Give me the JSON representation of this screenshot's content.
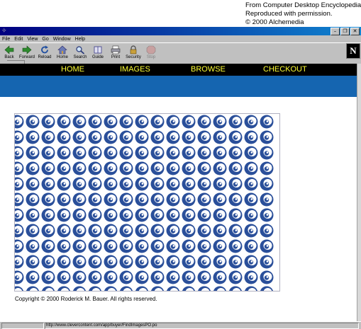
{
  "credit": {
    "line1": "From Computer Desktop Encyclopedia",
    "line2": "Reproduced with permission.",
    "line3": "© 2000 Alchemedia"
  },
  "menu": [
    "File",
    "Edit",
    "View",
    "Go",
    "Window",
    "Help"
  ],
  "toolbar": [
    {
      "label": "Back",
      "icon": "back-arrow-icon",
      "enabled": true
    },
    {
      "label": "Forward",
      "icon": "forward-arrow-icon",
      "enabled": true
    },
    {
      "label": "Reload",
      "icon": "reload-icon",
      "enabled": true
    },
    {
      "label": "Home",
      "icon": "home-icon",
      "enabled": true
    },
    {
      "label": "Search",
      "icon": "search-icon",
      "enabled": true
    },
    {
      "label": "Guide",
      "icon": "guide-icon",
      "enabled": true
    },
    {
      "label": "Print",
      "icon": "printer-icon",
      "enabled": true
    },
    {
      "label": "Security",
      "icon": "lock-icon",
      "enabled": true
    },
    {
      "label": "Stop",
      "icon": "stop-icon",
      "enabled": false
    }
  ],
  "logo": "N",
  "nav": {
    "home": "HOME",
    "images": "IMAGES",
    "browse": "BROWSE",
    "checkout": "CHECKOUT"
  },
  "colors": {
    "nav_text": "#ffff33",
    "nav_bg": "#000000",
    "band": "#1565b0",
    "pattern": "#2a4f9a"
  },
  "copyright": "Copyright © 2000 Roderick M. Bauer. All rights reserved.",
  "status": {
    "url": "http://www.clevercontent.com/app/buyer/FindImagesPO.po"
  }
}
